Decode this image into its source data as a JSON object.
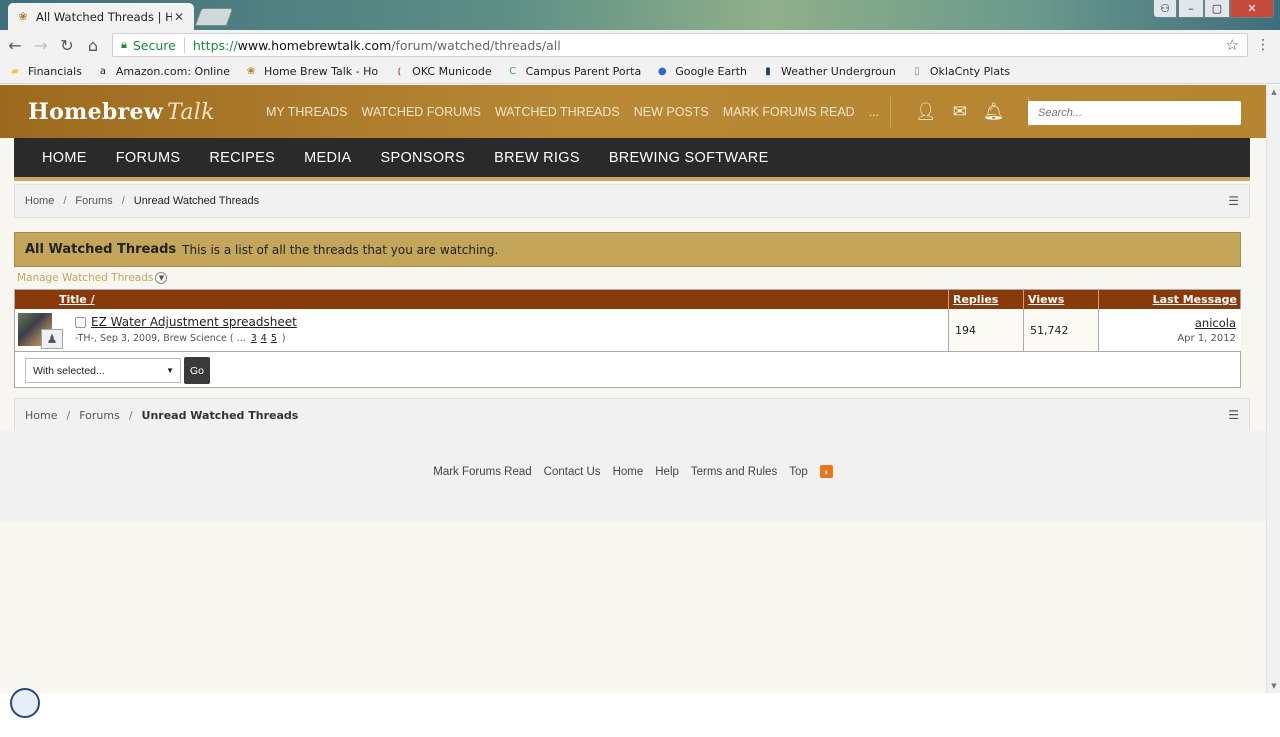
{
  "browser": {
    "tab_title": "All Watched Threads | Ho",
    "tab_close": "✕",
    "secure_label": "Secure",
    "url_scheme": "https://",
    "url_host": "www.homebrewtalk.com",
    "url_path": "/forum/watched/threads/all",
    "bookmarks": [
      {
        "label": "Financials",
        "icon": "folder-icon",
        "color": "#f4c542"
      },
      {
        "label": "Amazon.com: Online",
        "icon": "amazon-icon",
        "color": "#222222"
      },
      {
        "label": "Home Brew Talk - Ho",
        "icon": "homebrew-icon",
        "color": "#b07a1a"
      },
      {
        "label": "OKC Municode",
        "icon": "municode-icon",
        "color": "#a03020"
      },
      {
        "label": "Campus Parent Porta",
        "icon": "campus-icon",
        "color": "#3aa845"
      },
      {
        "label": "Google Earth",
        "icon": "earth-icon",
        "color": "#2a6ad0"
      },
      {
        "label": "Weather Undergroun",
        "icon": "weather-icon",
        "color": "#1a3a6a"
      },
      {
        "label": "OklaCnty Plats",
        "icon": "page-icon",
        "color": "#888888"
      }
    ]
  },
  "header": {
    "logo_main": "Homebrew",
    "logo_talk": "Talk",
    "top_links": [
      "MY THREADS",
      "WATCHED FORUMS",
      "WATCHED THREADS",
      "NEW POSTS",
      "MARK FORUMS READ",
      "..."
    ],
    "search_placeholder": "Search..."
  },
  "main_nav": [
    "HOME",
    "FORUMS",
    "RECIPES",
    "MEDIA",
    "SPONSORS",
    "BREW RIGS",
    "BREWING SOFTWARE"
  ],
  "breadcrumb": {
    "home": "Home",
    "forums": "Forums",
    "current": "Unread Watched Threads",
    "sep": "/"
  },
  "section": {
    "heading": "All Watched Threads",
    "description": "This is a list of all the threads that you are watching.",
    "manage_link": "Manage Watched Threads"
  },
  "table": {
    "col_title": "Title /",
    "col_replies": "Replies",
    "col_views": "Views",
    "col_last": "Last Message",
    "rows": [
      {
        "title": "EZ Water Adjustment spreadsheet",
        "meta": "-TH-, Sep 3, 2009, Brew Science ( ...",
        "pages": [
          "3",
          "4",
          "5"
        ],
        "meta_end": ")",
        "replies": "194",
        "views": "51,742",
        "last_user": "anicola",
        "last_date": "Apr 1, 2012"
      }
    ],
    "with_selected": "With selected...",
    "go_label": "Go"
  },
  "footer": {
    "links": [
      "Mark Forums Read",
      "Contact Us",
      "Home",
      "Help",
      "Terms and Rules",
      "Top"
    ]
  },
  "colors": {
    "header_gold": "#b88835",
    "nav_dark": "#2a2a2a",
    "title_bar": "#c3a65a",
    "table_head": "#8a3a0a"
  }
}
